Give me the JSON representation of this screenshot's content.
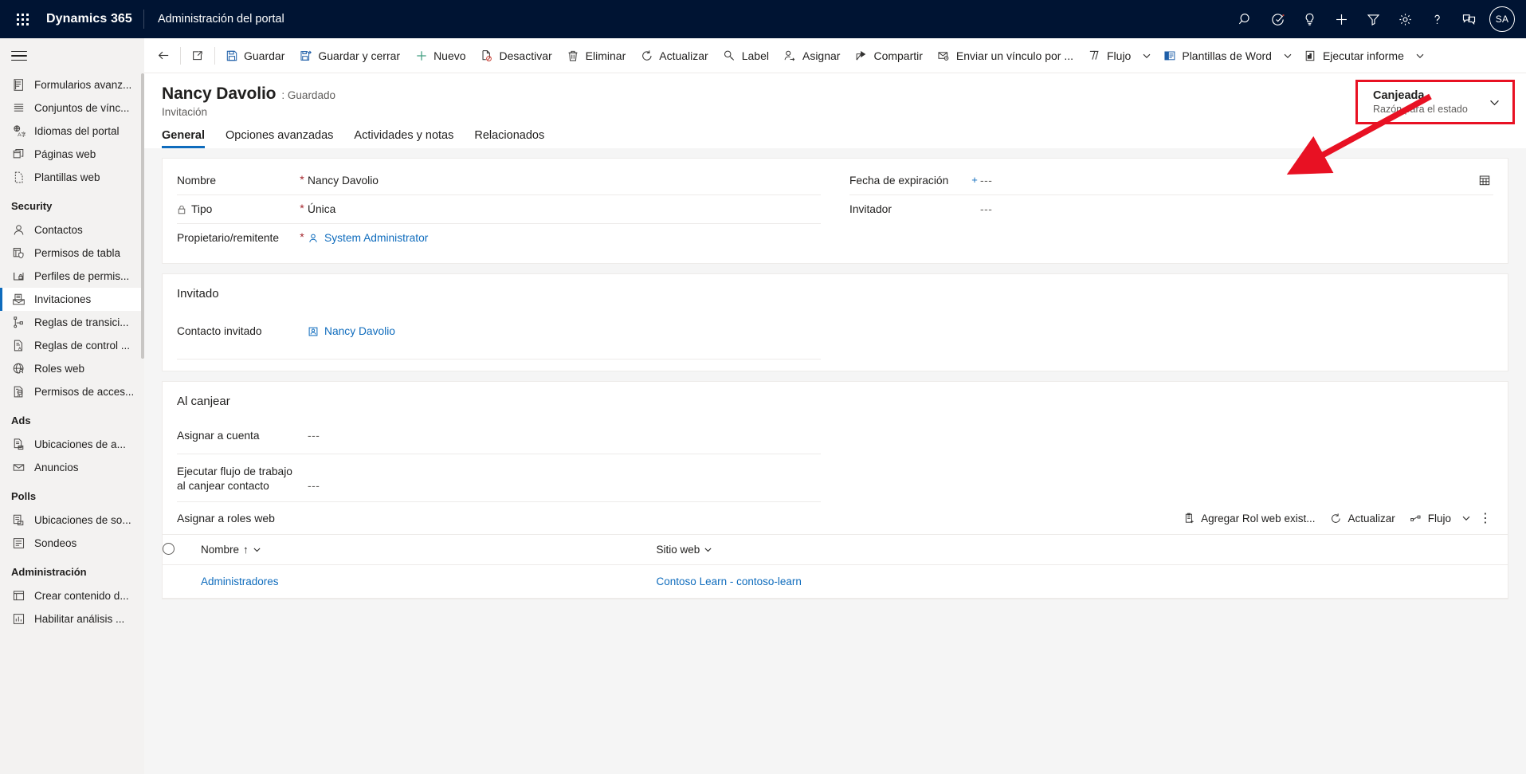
{
  "appbar": {
    "waffle": "app-launcher-icon",
    "brand": "Dynamics 365",
    "app_name": "Administración del portal",
    "icons": [
      {
        "name": "search-icon",
        "label": "Búsqueda"
      },
      {
        "name": "assistant-icon",
        "label": "Asistente"
      },
      {
        "name": "lightbulb-icon",
        "label": "Ideas"
      },
      {
        "name": "add-icon",
        "label": "Nuevo"
      },
      {
        "name": "filter-icon",
        "label": "Filtro"
      },
      {
        "name": "gear-icon",
        "label": "Configuración"
      },
      {
        "name": "help-icon",
        "label": "Ayuda"
      },
      {
        "name": "feedback-icon",
        "label": "Comentarios"
      }
    ],
    "avatar_initials": "SA"
  },
  "sidebar": {
    "hamburger": "hamburger-icon",
    "items": [
      {
        "label": "Formularios avanz...",
        "icon": "advanced-form-icon",
        "selected": false
      },
      {
        "label": "Conjuntos de vínc...",
        "icon": "link-sets-icon",
        "selected": false
      },
      {
        "label": "Idiomas del portal",
        "icon": "language-icon",
        "selected": false
      },
      {
        "label": "Páginas web",
        "icon": "web-page-icon",
        "selected": false
      },
      {
        "label": "Plantillas web",
        "icon": "web-template-icon",
        "selected": false
      }
    ],
    "groups": [
      {
        "title": "Security",
        "items": [
          {
            "label": "Contactos",
            "icon": "contact-icon",
            "selected": false
          },
          {
            "label": "Permisos de tabla",
            "icon": "table-permission-icon",
            "selected": false
          },
          {
            "label": "Perfiles de permis...",
            "icon": "permission-profile-icon",
            "selected": false
          },
          {
            "label": "Invitaciones",
            "icon": "invitation-icon",
            "selected": true
          },
          {
            "label": "Reglas de transici...",
            "icon": "transition-rule-icon",
            "selected": false
          },
          {
            "label": "Reglas de control ...",
            "icon": "control-rule-icon",
            "selected": false
          },
          {
            "label": "Roles web",
            "icon": "web-role-icon",
            "selected": false
          },
          {
            "label": "Permisos de acces...",
            "icon": "access-permission-icon",
            "selected": false
          }
        ]
      },
      {
        "title": "Ads",
        "items": [
          {
            "label": "Ubicaciones de a...",
            "icon": "ad-placement-icon",
            "selected": false
          },
          {
            "label": "Anuncios",
            "icon": "ad-icon",
            "selected": false
          }
        ]
      },
      {
        "title": "Polls",
        "items": [
          {
            "label": "Ubicaciones de so...",
            "icon": "poll-placement-icon",
            "selected": false
          },
          {
            "label": "Sondeos",
            "icon": "poll-icon",
            "selected": false
          }
        ]
      },
      {
        "title": "Administración",
        "items": [
          {
            "label": "Crear contenido d...",
            "icon": "create-content-icon",
            "selected": false
          },
          {
            "label": "Habilitar análisis ...",
            "icon": "enable-analytics-icon",
            "selected": false
          }
        ]
      }
    ]
  },
  "commandbar": {
    "back": "back-arrow-icon",
    "open_new_window": "open-in-new-window-icon",
    "buttons": [
      {
        "label": "Guardar",
        "icon": "save-icon",
        "caret": false
      },
      {
        "label": "Guardar y cerrar",
        "icon": "save-and-close-icon",
        "caret": false
      },
      {
        "label": "Nuevo",
        "icon": "plus-icon",
        "caret": false
      },
      {
        "label": "Desactivar",
        "icon": "deactivate-icon",
        "caret": false
      },
      {
        "label": "Eliminar",
        "icon": "trash-icon",
        "caret": false
      },
      {
        "label": "Actualizar",
        "icon": "refresh-icon",
        "caret": false
      },
      {
        "label": "Label",
        "icon": "label-search-icon",
        "caret": false
      },
      {
        "label": "Asignar",
        "icon": "assign-user-icon",
        "caret": false
      },
      {
        "label": "Compartir",
        "icon": "share-icon",
        "caret": false
      },
      {
        "label": "Enviar un vínculo por ...",
        "icon": "email-link-icon",
        "caret": false
      },
      {
        "label": "Flujo",
        "icon": "flow-icon",
        "caret": true
      },
      {
        "label": "Plantillas de Word",
        "icon": "word-template-icon",
        "caret": true
      },
      {
        "label": "Ejecutar informe",
        "icon": "run-report-icon",
        "caret": true
      }
    ]
  },
  "record": {
    "title": "Nancy Davolio",
    "state_separator": ": Guardado",
    "entity": "Invitación",
    "status": {
      "value": "Canjeada",
      "label": "Razón para el estado",
      "caret_icon": "chevron-down-icon",
      "highlight_color": "#e81123"
    }
  },
  "tabs": [
    {
      "label": "General",
      "active": true
    },
    {
      "label": "Opciones avanzadas",
      "active": false
    },
    {
      "label": "Actividades y notas",
      "active": false
    },
    {
      "label": "Relacionados",
      "active": false
    }
  ],
  "form": {
    "general": {
      "left_fields": [
        {
          "label": "Nombre",
          "required": "*",
          "value": "Nancy Davolio",
          "type": "text",
          "locked": false
        },
        {
          "label": "Tipo",
          "required": "*",
          "value": "Única",
          "type": "text",
          "locked": true,
          "lock_icon": "lock-icon"
        },
        {
          "label": "Propietario/remitente",
          "required": "*",
          "value": "System Administrator",
          "type": "lookup",
          "icon": "user-icon",
          "locked": false
        }
      ],
      "right_fields": [
        {
          "label": "Fecha de expiración",
          "required": "+",
          "value": "---",
          "type": "date",
          "trailing_icon": "calendar-icon"
        },
        {
          "label": "Invitador",
          "required": "",
          "value": "---",
          "type": "text"
        }
      ]
    },
    "invitado": {
      "title": "Invitado",
      "fields": [
        {
          "label": "Contacto invitado",
          "required": "",
          "value": "Nancy Davolio",
          "type": "lookup",
          "icon": "contact-card-icon"
        }
      ]
    },
    "al_canjear": {
      "title": "Al canjear",
      "fields": [
        {
          "label": "Asignar a cuenta",
          "required": "",
          "value": "---",
          "type": "text"
        },
        {
          "label": "Ejecutar flujo de trabajo al canjear contacto",
          "required": "",
          "value": "---",
          "type": "text"
        }
      ]
    },
    "subgrid": {
      "title": "Asignar a roles web",
      "tools": [
        {
          "label": "Agregar Rol web exist...",
          "icon": "add-existing-icon",
          "caret": false
        },
        {
          "label": "Actualizar",
          "icon": "refresh-icon",
          "caret": false
        },
        {
          "label": "Flujo",
          "icon": "flow-icon",
          "caret": true
        }
      ],
      "more_icon": "more-vertical-icon",
      "columns": [
        {
          "label": "Nombre",
          "sort": "↑",
          "caret_icon": "chevron-down-icon"
        },
        {
          "label": "Sitio web",
          "sort": "",
          "caret_icon": "chevron-down-icon"
        }
      ],
      "select_all_icon": "select-all-radio-icon",
      "rows": [
        {
          "nombre": "Administradores",
          "sitio_web": "Contoso Learn - contoso-learn"
        }
      ]
    }
  },
  "colors": {
    "appbar_bg": "#001433",
    "accent": "#0f6cbd",
    "link": "#0f6cbd",
    "required": "#a4262c",
    "highlight": "#e81123",
    "sidebar_bg": "#f3f2f1",
    "canvas_bg": "#f5f5f5"
  }
}
